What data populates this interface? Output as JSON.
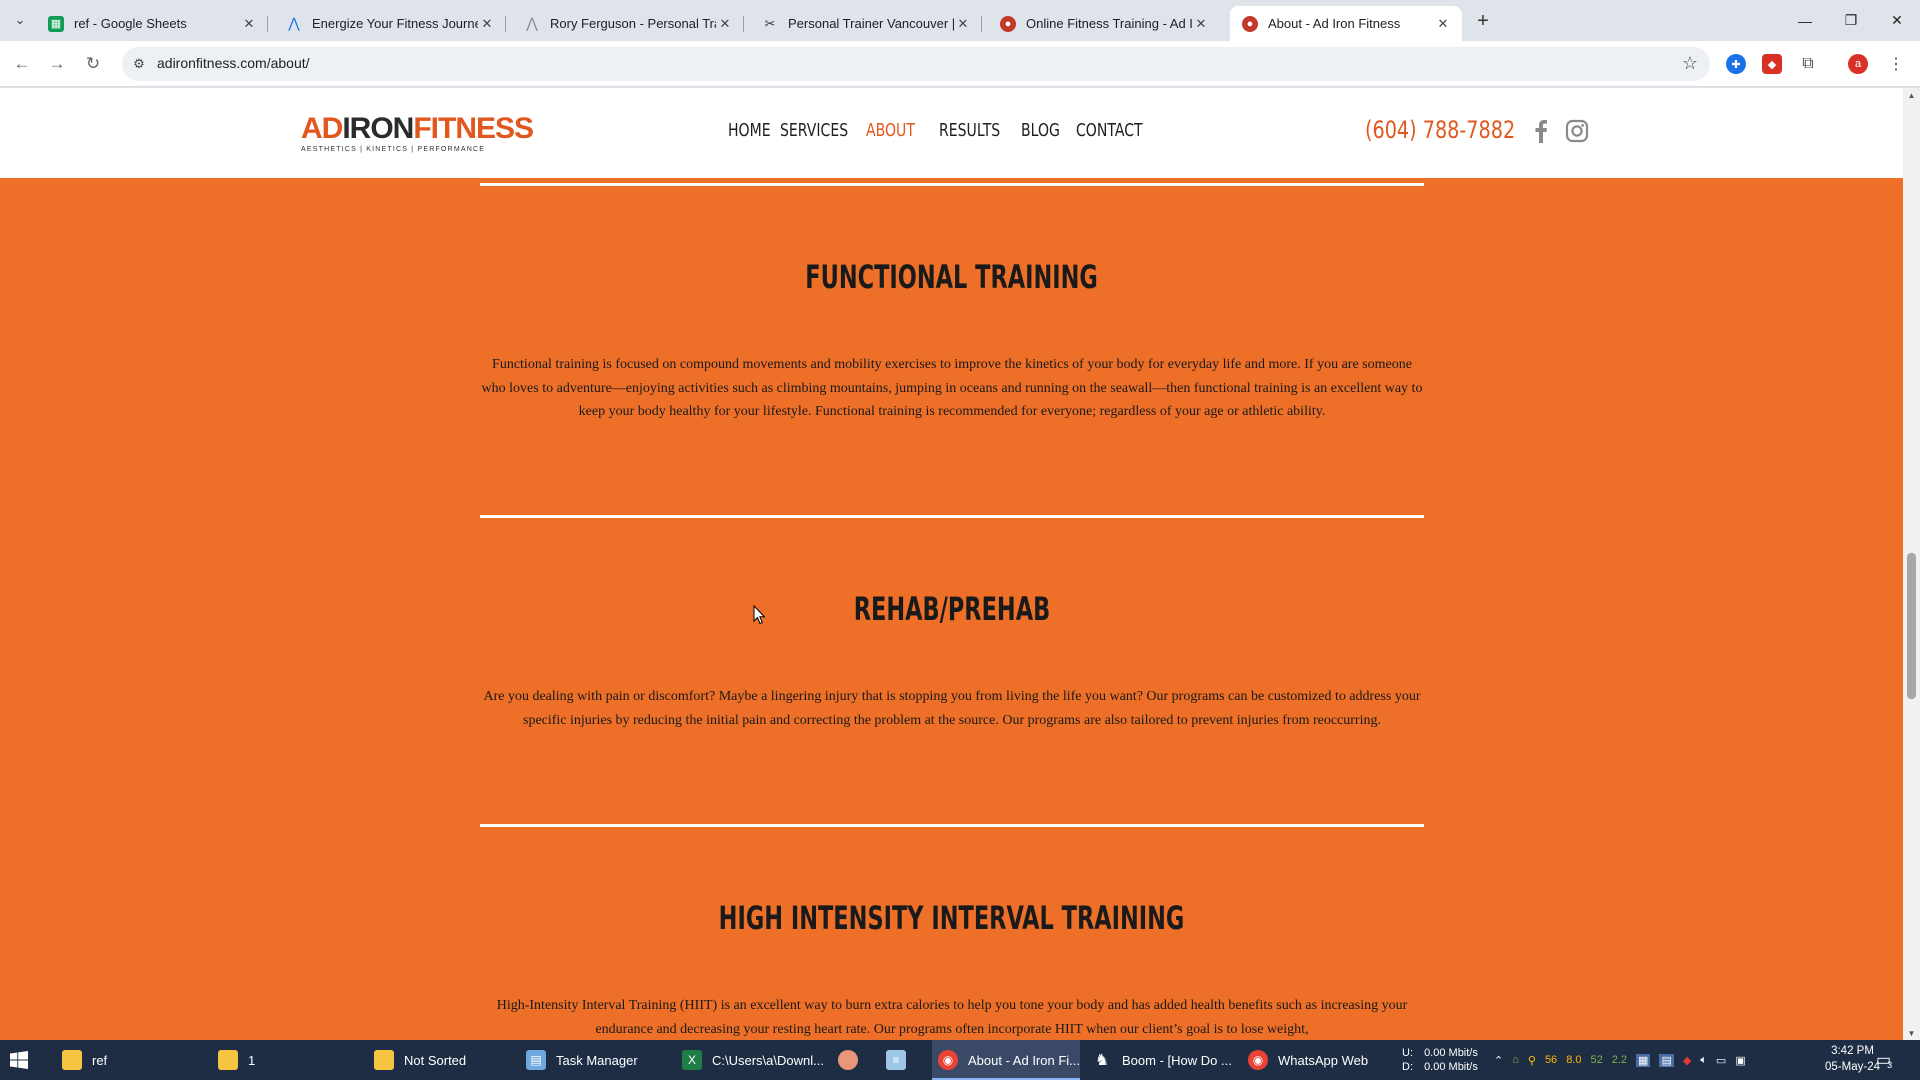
{
  "browser": {
    "tabs": [
      {
        "title": "ref - Google Sheets",
        "icon": "sheets-icon",
        "color": "#0f9d58"
      },
      {
        "title": "Energize Your Fitness Journey w",
        "icon": "arrow-logo-icon",
        "color": "#1a73e8"
      },
      {
        "title": "Rory Ferguson - Personal Traini",
        "icon": "arrow-logo-icon",
        "color": "#888888"
      },
      {
        "title": "Personal Trainer Vancouver | Wo",
        "icon": "trainer-icon",
        "color": "#333333"
      },
      {
        "title": "Online Fitness Training - Ad Iro",
        "icon": "globe-icon",
        "color": "#c0392b"
      },
      {
        "title": "About - Ad Iron Fitness",
        "icon": "globe-icon",
        "color": "#c0392b",
        "active": true
      }
    ],
    "url": "adironfitness.com/about/"
  },
  "site": {
    "logo": {
      "ad": "AD",
      "iron": "IRON",
      "fitness": "FITNESS",
      "tagline": "AESTHETICS | KINETICS | PERFORMANCE"
    },
    "menu": [
      {
        "label": "HOME"
      },
      {
        "label": "SERVICES"
      },
      {
        "label": "ABOUT",
        "current": true
      },
      {
        "label": "RESULTS"
      },
      {
        "label": "BLOG"
      },
      {
        "label": "CONTACT"
      }
    ],
    "phone": "(604) 788-7882",
    "brand_color": "#ee6f28",
    "sections": [
      {
        "title": "FUNCTIONAL TRAINING",
        "body": "Functional training is focused on compound movements and mobility exercises to improve the kinetics of your body for everyday life and more. If you are someone who loves to adventure—enjoying activities such as climbing mountains, jumping in oceans and running on the seawall—then functional training is an excellent way to keep your body healthy for your lifestyle. Functional training is recommended for everyone; regardless of your age or athletic ability."
      },
      {
        "title": "REHAB/PREHAB",
        "body": "Are you dealing with pain or discomfort? Maybe a lingering injury that is stopping you from living the life you want? Our programs can be customized to address your specific injuries by reducing the initial pain and correcting the problem at the source. Our programs are also tailored to prevent injuries from reoccurring."
      },
      {
        "title": "HIGH INTENSITY INTERVAL TRAINING",
        "body": "High-Intensity Interval Training (HIIT) is an excellent way to burn extra calories to help you tone your body and has added health benefits such as increasing your endurance and decreasing your resting heart rate. Our programs often incorporate HIIT when our client’s goal is to lose weight,"
      }
    ]
  },
  "taskbar": {
    "items": [
      {
        "label": "ref",
        "icon": "folder-icon"
      },
      {
        "label": "1",
        "icon": "folder-icon"
      },
      {
        "label": "Not Sorted",
        "icon": "folder-icon"
      },
      {
        "label": "Task Manager",
        "icon": "task-manager-icon"
      },
      {
        "label": "C:\\Users\\a\\Downl...",
        "icon": "excel-icon"
      },
      {
        "label": "",
        "icon": "app-icon"
      },
      {
        "label": "",
        "icon": "notepad-icon"
      },
      {
        "label": "About - Ad Iron Fi...",
        "icon": "chrome-icon",
        "active": true
      },
      {
        "label": "Boom - [How Do ...",
        "icon": "boom-icon"
      },
      {
        "label": "WhatsApp Web",
        "icon": "chrome-icon"
      }
    ],
    "network": {
      "up_label": "U:",
      "down_label": "D:",
      "up": "0.00 Mbit/s",
      "down": "0.00 Mbit/s"
    },
    "tray_numbers": [
      "56",
      "8.0",
      "52",
      "2.2"
    ],
    "time": "3:42 PM",
    "date": "05-May-24",
    "notifications": "3"
  }
}
